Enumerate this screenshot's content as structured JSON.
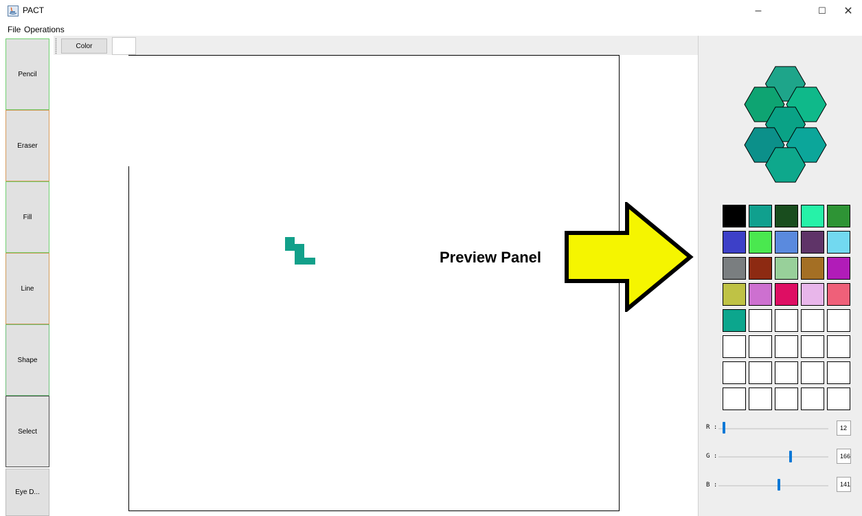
{
  "window": {
    "title": "PACT",
    "icon": "java-app-icon",
    "controls": {
      "minimize": "–",
      "maximize": "☐",
      "close": "✕"
    }
  },
  "menu": [
    "File",
    "Operations"
  ],
  "tools": [
    "Pencil",
    "Eraser",
    "Fill",
    "Line",
    "Shape",
    "Select",
    "Eye D..."
  ],
  "top_strip": {
    "color_button": "Color"
  },
  "canvas": {
    "annotation": "Preview Panel",
    "arrow_color": "#f5f500",
    "pixel_color": "#12a08a"
  },
  "preview": {
    "hex_colors": [
      "#1ea58a",
      "#0ea472",
      "#0fb98a",
      "#0aa286",
      "#0c908a",
      "#0ca69a",
      "#0ea88c"
    ]
  },
  "palette": [
    "#000000",
    "#10a08e",
    "#194d1e",
    "#26f2a8",
    "#2e9435",
    "#3d40c8",
    "#4ae84f",
    "#5a8ade",
    "#5f3468",
    "#72d9f0",
    "#7a7e80",
    "#8d2a12",
    "#98d09a",
    "#a46f24",
    "#b11cb8",
    "#bfc245",
    "#cd70d0",
    "#de0e63",
    "#e8b6ea",
    "#ef6079",
    "#0ca68d",
    "#ffffff",
    "#ffffff",
    "#ffffff",
    "#ffffff",
    "#ffffff",
    "#ffffff",
    "#ffffff",
    "#ffffff",
    "#ffffff",
    "#ffffff",
    "#ffffff",
    "#ffffff",
    "#ffffff",
    "#ffffff",
    "#ffffff",
    "#ffffff",
    "#ffffff",
    "#ffffff",
    "#ffffff"
  ],
  "sliders": [
    {
      "label": "R :",
      "value": "12"
    },
    {
      "label": "G :",
      "value": "166"
    },
    {
      "label": "B :",
      "value": "141"
    }
  ]
}
